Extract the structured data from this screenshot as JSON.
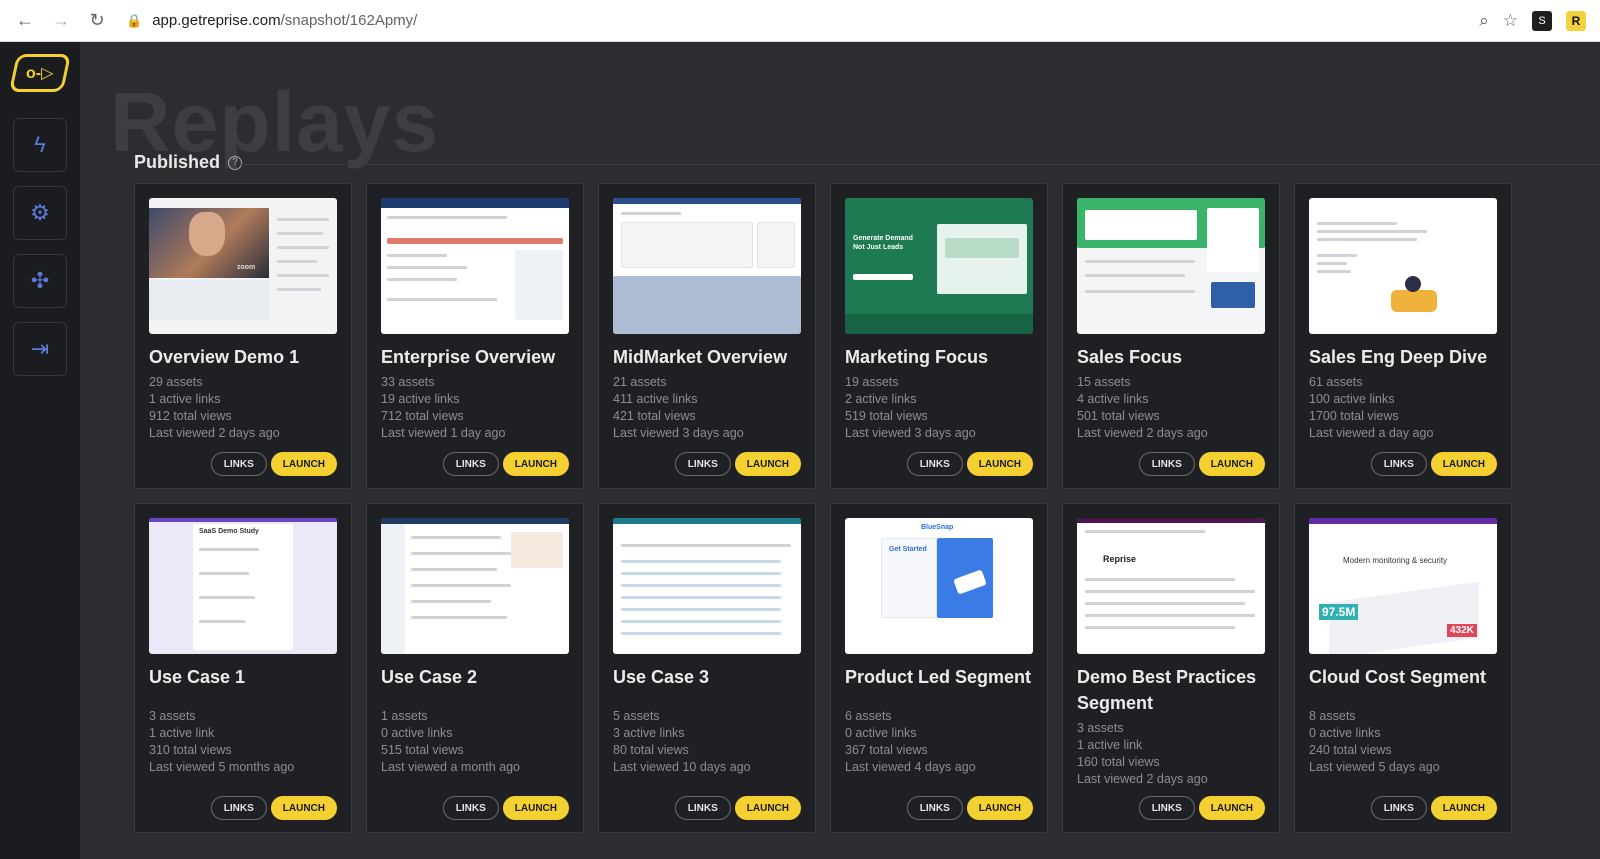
{
  "browser": {
    "url_host": "app.getreprise.com",
    "url_path": "/snapshot/162Apmy/",
    "ext_b_label": "S",
    "ext_r_label": "R"
  },
  "sidebar": {
    "logo_glyph": "o-▷"
  },
  "page": {
    "big_title": "Replays",
    "section_label": "Published",
    "help_glyph": "?"
  },
  "buttons": {
    "links": "LINKS",
    "launch": "LAUNCH"
  },
  "cards": [
    {
      "title": "Overview Demo 1",
      "assets": "29 assets",
      "links": "1 active links",
      "views": "912 total views",
      "last": "Last viewed 2 days ago"
    },
    {
      "title": "Enterprise Overview",
      "assets": "33 assets",
      "links": "19 active links",
      "views": "712 total views",
      "last": "Last viewed 1 day ago"
    },
    {
      "title": "MidMarket Overview",
      "assets": "21 assets",
      "links": "411 active links",
      "views": "421 total views",
      "last": "Last viewed 3 days ago"
    },
    {
      "title": "Marketing Focus",
      "assets": "19 assets",
      "links": "2 active links",
      "views": "519 total views",
      "last": "Last viewed 3 days ago"
    },
    {
      "title": "Sales Focus",
      "assets": "15 assets",
      "links": "4 active links",
      "views": "501 total views",
      "last": "Last viewed 2 days ago"
    },
    {
      "title": "Sales Eng Deep Dive",
      "assets": "61 assets",
      "links": "100 active links",
      "views": "1700 total views",
      "last": "Last viewed a day ago"
    },
    {
      "title": "Use Case 1",
      "assets": "3 assets",
      "links": "1 active link",
      "views": "310 total views",
      "last": "Last viewed 5 months ago"
    },
    {
      "title": "Use Case 2",
      "assets": "1 assets",
      "links": "0 active links",
      "views": "515 total views",
      "last": "Last viewed a month ago"
    },
    {
      "title": "Use Case 3",
      "assets": "5 assets",
      "links": "3 active links",
      "views": "80 total views",
      "last": "Last viewed 10 days ago"
    },
    {
      "title": "Product Led Segment",
      "assets": "6 assets",
      "links": "0 active links",
      "views": "367 total views",
      "last": "Last viewed 4 days ago"
    },
    {
      "title": "Demo Best Practices Segment",
      "assets": "3 assets",
      "links": "1 active link",
      "views": "160 total views",
      "last": "Last viewed 2 days ago"
    },
    {
      "title": "Cloud Cost Segment",
      "assets": "8 assets",
      "links": "0 active links",
      "views": "240 total views",
      "last": "Last viewed 5 days ago"
    }
  ],
  "thumbs": {
    "t1_zoom": "zoom",
    "t4_headline": "Generate Demand Not Just Leads",
    "t10_brand": "BlueSnap",
    "t10_cta": "Get Started",
    "t11_brand": "Reprise",
    "t12_headline": "Modern monitoring & security",
    "t12_stat1": "97.5M",
    "t12_stat2": "432K",
    "t7_heading": "SaaS Demo Study"
  },
  "colors": {
    "accent": "#f5d031",
    "background": "#2b2d30",
    "card": "#1f2023",
    "sidebar_icon": "#5a7bd8"
  }
}
